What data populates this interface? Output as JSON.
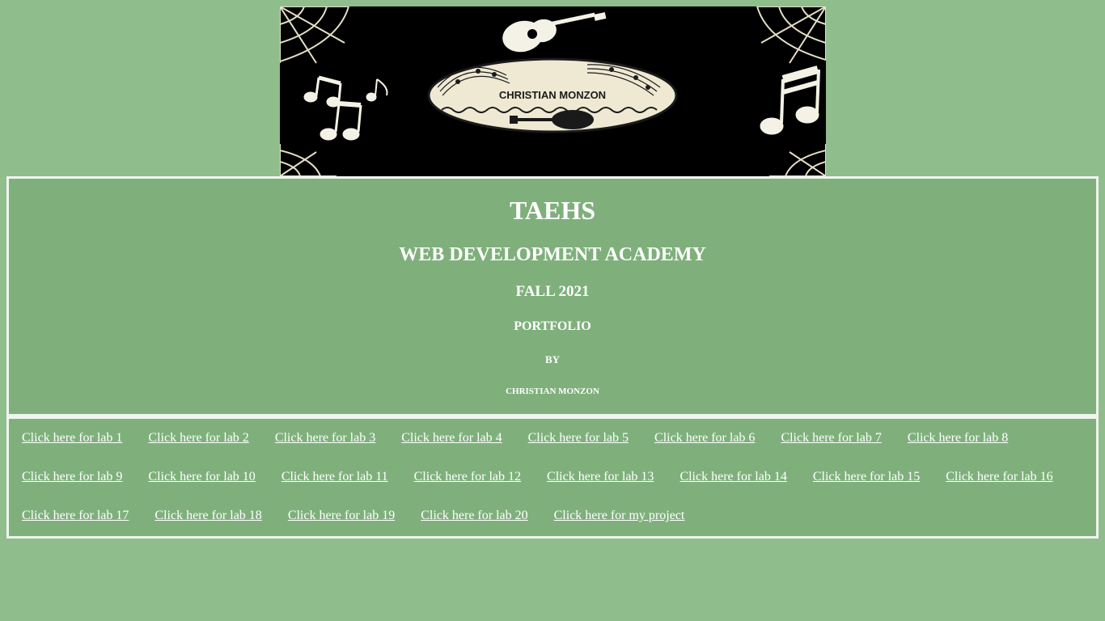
{
  "banner": {
    "name_text": "CHRISTIAN MONZON"
  },
  "header": {
    "school": "TAEHS",
    "academy": "WEB DEVELOPMENT ACADEMY",
    "term": "FALL 2021",
    "portfolio": "PORTFOLIO",
    "by": "BY",
    "author": "CHRISTIAN MONZON"
  },
  "links": {
    "row1": [
      "Click here for lab 1",
      "Click here for lab 2",
      "Click here for lab 3",
      "Click here for lab 4",
      "Click here for lab 5",
      "Click here for lab 6",
      "Click here for lab 7",
      "Click here for lab 8"
    ],
    "row2": [
      "Click here for lab 9",
      "Click here for lab 10",
      "Click here for lab 11",
      "Click here for lab 12",
      "Click here for lab 13",
      "Click here for lab 14",
      "Click here for lab 15",
      "Click here for lab 16"
    ],
    "row3": [
      "Click here for lab 17",
      "Click here for lab 18",
      "Click here for lab 19",
      "Click here for lab 20",
      "Click here for my project"
    ]
  },
  "colors": {
    "page_bg": "#8fbe8c",
    "panel_bg": "#7fb07c",
    "border": "#f0f4ef",
    "text": "#ffffff",
    "banner_bg": "#000000",
    "oval_fill": "#efe9d3"
  }
}
